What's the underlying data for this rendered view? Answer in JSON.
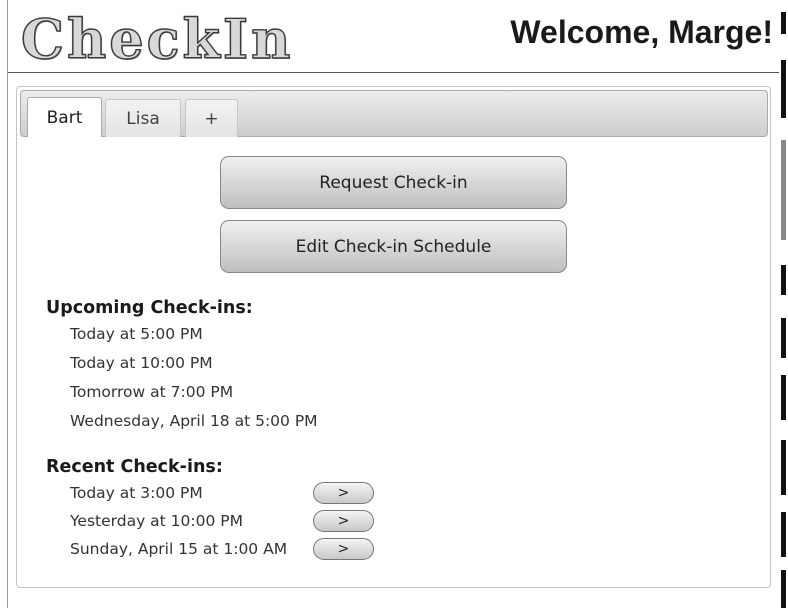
{
  "app": {
    "logo_text": "CheckIn",
    "welcome": "Welcome, Marge!"
  },
  "tabs": [
    {
      "label": "Bart",
      "active": true
    },
    {
      "label": "Lisa",
      "active": false
    },
    {
      "label": "+",
      "active": false
    }
  ],
  "actions": {
    "request_label": "Request Check-in",
    "edit_label": "Edit Check-in Schedule"
  },
  "upcoming": {
    "title": "Upcoming Check-ins:",
    "items": [
      "Today at 5:00 PM",
      "Today at 10:00 PM",
      "Tomorrow at 7:00 PM",
      "Wednesday, April 18 at 5:00 PM"
    ]
  },
  "recent": {
    "title": "Recent Check-ins:",
    "items": [
      {
        "label": "Today at 3:00 PM",
        "button": ">"
      },
      {
        "label": "Yesterday at 10:00 PM",
        "button": ">"
      },
      {
        "label": "Sunday, April 15 at 1:00 AM",
        "button": ">"
      }
    ]
  }
}
